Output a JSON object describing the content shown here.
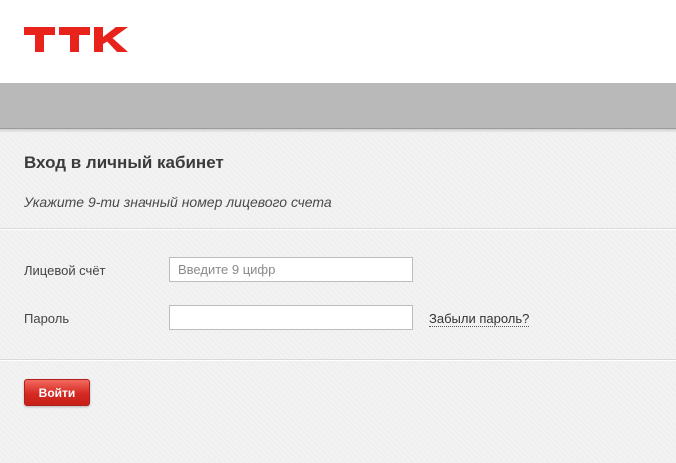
{
  "logo": {
    "text": "ТТК",
    "color": "#e8231c"
  },
  "form": {
    "title": "Вход в личный кабинет",
    "hint": "Укажите 9-ти значный номер лицевого счета",
    "account": {
      "label": "Лицевой счёт",
      "placeholder": "Введите 9 цифр",
      "value": ""
    },
    "password": {
      "label": "Пароль",
      "value": ""
    },
    "forgot_link": "Забыли пароль?",
    "submit_label": "Войти"
  },
  "colors": {
    "accent": "#d52a23",
    "band": "#b9b9b9",
    "background": "#f2f2f2"
  }
}
